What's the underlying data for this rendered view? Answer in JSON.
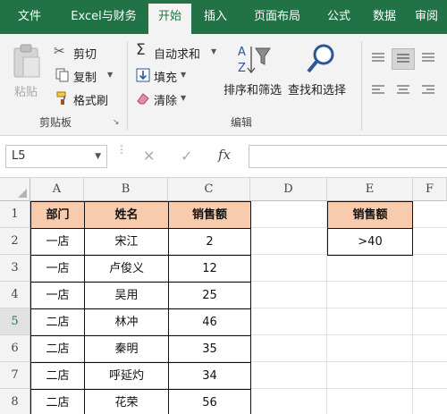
{
  "tabs": [
    "文件",
    "Excel与财务",
    "开始",
    "插入",
    "页面布局",
    "公式",
    "数据",
    "审阅"
  ],
  "active_tab": "开始",
  "colors": {
    "accent": "#217346",
    "header_fill": "#f8cbad"
  },
  "ribbon": {
    "clipboard": {
      "paste_label": "粘贴",
      "cut_label": "剪切",
      "copy_label": "复制",
      "format_painter_label": "格式刷",
      "group_label": "剪贴板"
    },
    "editing": {
      "autosum_label": "自动求和",
      "fill_label": "填充",
      "clear_label": "清除",
      "sort_filter_label": "排序和筛选",
      "find_select_label": "查找和选择",
      "group_label": "编辑"
    }
  },
  "formula_bar": {
    "name_box": "L5",
    "fx_label": "fx",
    "formula": ""
  },
  "sheet": {
    "columns": [
      "A",
      "B",
      "C",
      "D",
      "E",
      "F"
    ],
    "rows": [
      "1",
      "2",
      "3",
      "4",
      "5",
      "6",
      "7",
      "8"
    ],
    "selected_row": "5",
    "table_headers": [
      "部门",
      "姓名",
      "销售额"
    ],
    "table_rows": [
      [
        "一店",
        "宋江",
        "2"
      ],
      [
        "一店",
        "卢俊义",
        "12"
      ],
      [
        "一店",
        "吴用",
        "25"
      ],
      [
        "二店",
        "林冲",
        "46"
      ],
      [
        "二店",
        "秦明",
        "35"
      ],
      [
        "二店",
        "呼延灼",
        "34"
      ],
      [
        "二店",
        "花荣",
        "56"
      ]
    ],
    "criteria_header": "销售额",
    "criteria_value": ">40"
  }
}
